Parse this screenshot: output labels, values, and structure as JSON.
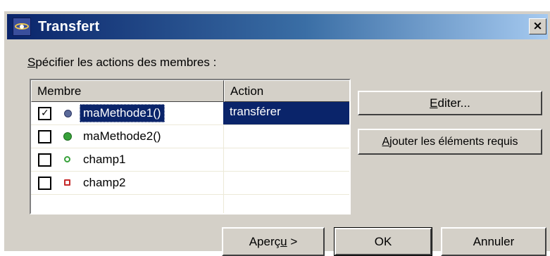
{
  "window": {
    "title": "Transfert",
    "close_glyph": "×"
  },
  "prompt": {
    "mnemonic": "S",
    "text_rest": "pécifier les actions des membres :"
  },
  "table": {
    "columns": [
      "Membre",
      "Action"
    ],
    "rows": [
      {
        "checked": true,
        "icon": "method-default-icon",
        "name": "maMethode1()",
        "action": "transférer",
        "selected": true
      },
      {
        "checked": false,
        "icon": "method-public-icon",
        "name": "maMethode2()",
        "action": "",
        "selected": false
      },
      {
        "checked": false,
        "icon": "field-public-icon",
        "name": "champ1",
        "action": "",
        "selected": false
      },
      {
        "checked": false,
        "icon": "field-private-icon",
        "name": "champ2",
        "action": "",
        "selected": false
      }
    ]
  },
  "buttons": {
    "edit": {
      "mnemonic": "E",
      "rest": "diter..."
    },
    "add": {
      "mnemonic": "A",
      "rest": "jouter les éléments requis"
    },
    "preview": {
      "before": "Aperç",
      "mnemonic": "u",
      "after": " >"
    },
    "ok": {
      "label": "OK"
    },
    "cancel": {
      "label": "Annuler"
    }
  },
  "colors": {
    "titlebar_start": "#0a246a",
    "titlebar_end": "#a6caf0",
    "selection": "#0a246a",
    "dialog_face": "#d4d0c8"
  }
}
